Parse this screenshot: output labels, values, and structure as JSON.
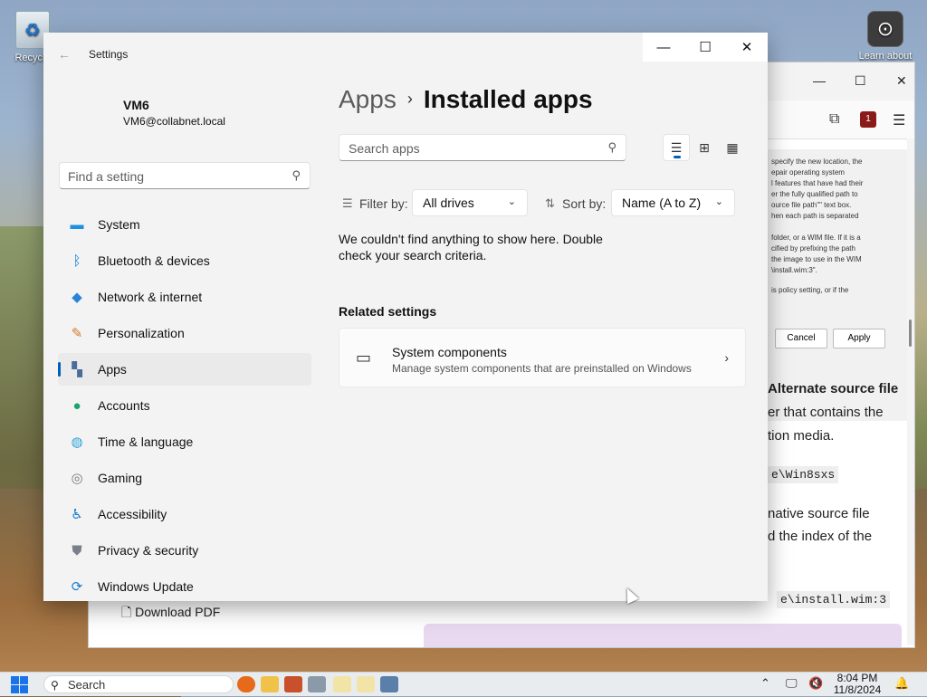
{
  "desktop": {
    "recycle_label": "Recycle",
    "learn_label": "Learn about"
  },
  "browser": {
    "doc_lines": [
      "specify the new location, the",
      "epair operating system",
      "l features that have had their",
      "er the fully qualified path to",
      "ource file path\"\" text box.",
      "hen each path is separated",
      "folder, or a WIM file. If it is a",
      "cified by prefixing the path",
      "the image to use in the WIM",
      "\\install.wim:3\".",
      "is policy setting, or if the"
    ],
    "cancel": "Cancel",
    "apply": "Apply",
    "heading": "Alternate source file",
    "para1_l1": "er that contains the",
    "para1_l2": "tion media.",
    "code1": "e\\Win8sxs",
    "para2_l1": "native source file",
    "para2_l2": "d the index of the",
    "code2": "e\\install.wim:3",
    "download": "Download PDF",
    "badge": "1"
  },
  "settings": {
    "window_title": "Settings",
    "user_name": "VM6",
    "user_email": "VM6@collabnet.local",
    "find_placeholder": "Find a setting",
    "nav": [
      {
        "label": "System",
        "icon": "monitor-icon",
        "color": "#1e90e0"
      },
      {
        "label": "Bluetooth & devices",
        "icon": "bluetooth-icon",
        "color": "#0a7ad6"
      },
      {
        "label": "Network & internet",
        "icon": "wifi-icon",
        "color": "#2a83d6"
      },
      {
        "label": "Personalization",
        "icon": "brush-icon",
        "color": "#d07a2a"
      },
      {
        "label": "Apps",
        "icon": "apps-icon",
        "color": "#4b6b9a"
      },
      {
        "label": "Accounts",
        "icon": "person-icon",
        "color": "#1aa36a"
      },
      {
        "label": "Time & language",
        "icon": "globe-clock-icon",
        "color": "#2ba3d9"
      },
      {
        "label": "Gaming",
        "icon": "gamepad-icon",
        "color": "#7a7a7a"
      },
      {
        "label": "Accessibility",
        "icon": "accessibility-icon",
        "color": "#1577c8"
      },
      {
        "label": "Privacy & security",
        "icon": "shield-icon",
        "color": "#7a8089"
      },
      {
        "label": "Windows Update",
        "icon": "update-icon",
        "color": "#1a7bd0"
      }
    ],
    "selected_nav": "Apps",
    "breadcrumb_parent": "Apps",
    "breadcrumb_current": "Installed apps",
    "search_apps_placeholder": "Search apps",
    "filter_label": "Filter by:",
    "filter_value": "All drives",
    "sort_label": "Sort by:",
    "sort_value": "Name (A to Z)",
    "empty_message": "We couldn't find anything to show here. Double check your search criteria.",
    "related_heading": "Related settings",
    "related_title": "System components",
    "related_subtitle": "Manage system components that are preinstalled on Windows",
    "accent": "#005fb8"
  },
  "taskbar": {
    "search_label": "Search",
    "time": "8:04 PM",
    "date": "11/8/2024"
  }
}
